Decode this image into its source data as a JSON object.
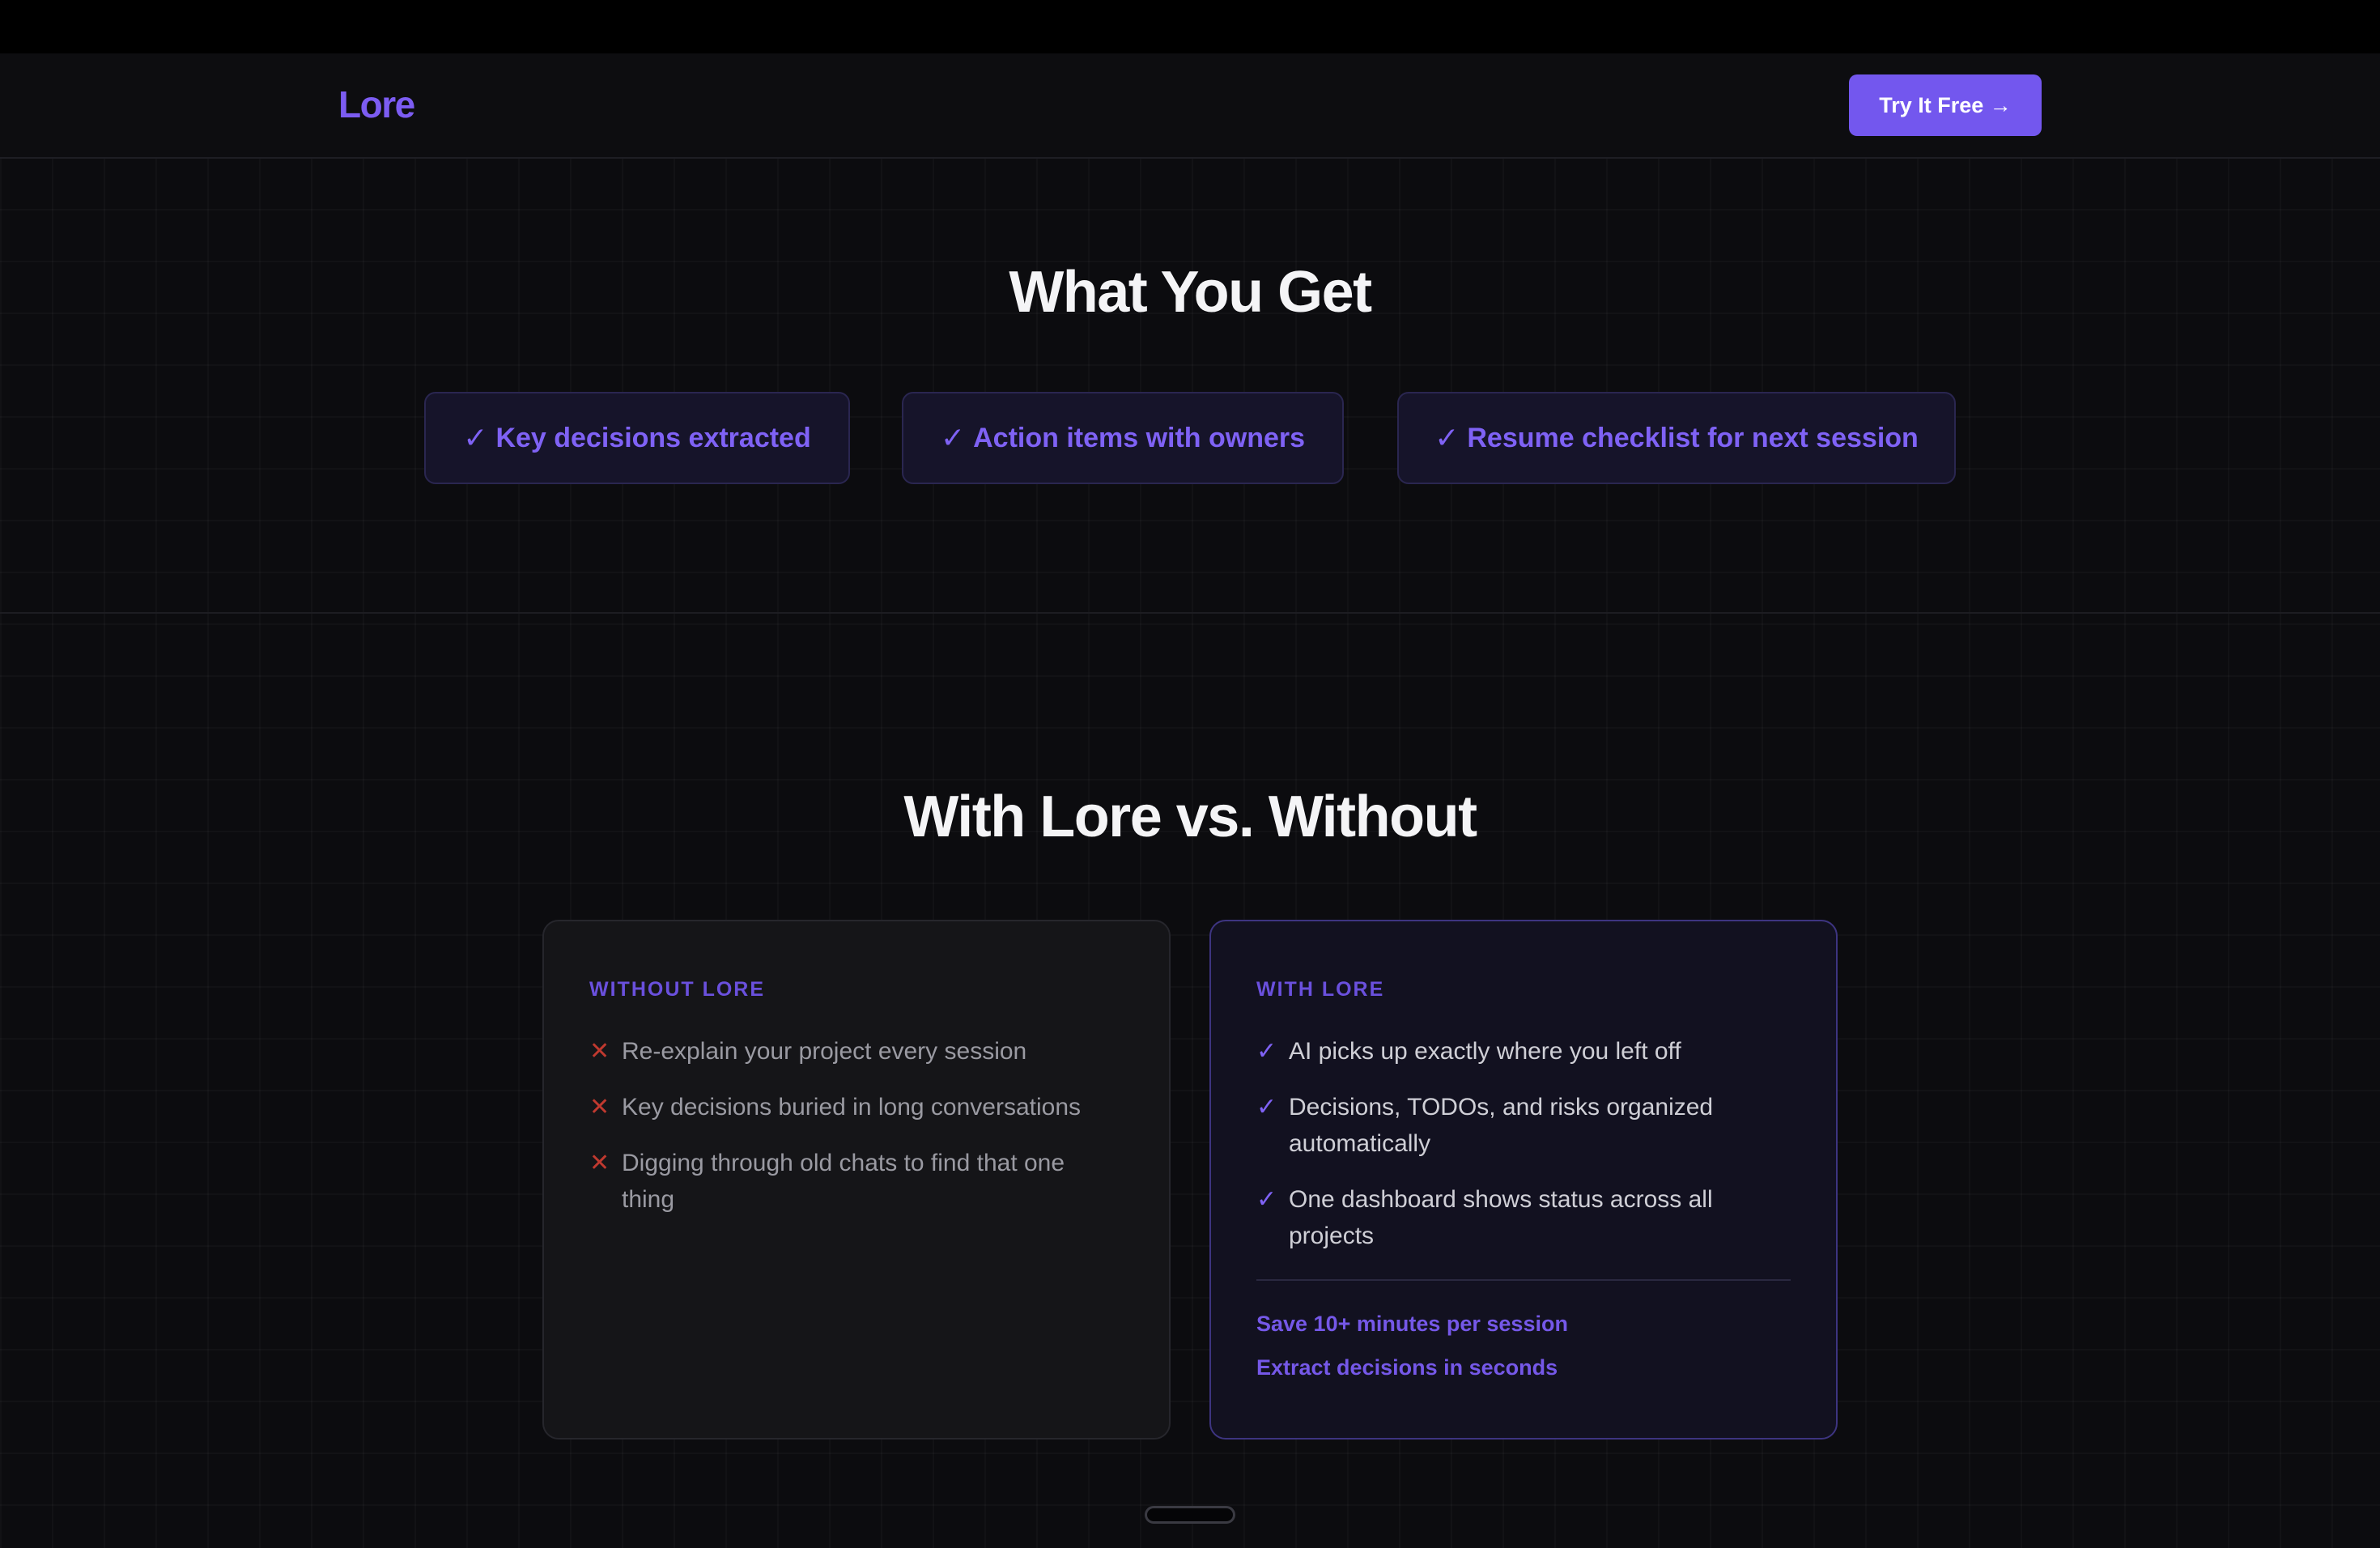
{
  "nav": {
    "logo": "Lore",
    "cta_label": "Try It Free →"
  },
  "what_you_get": {
    "title": "What You Get",
    "check_glyph": "✓",
    "items": [
      "Key decisions extracted",
      "Action items with owners",
      "Resume checklist for next session"
    ]
  },
  "comparison": {
    "title": "With Lore vs. Without",
    "without": {
      "heading": "WITHOUT LORE",
      "mark_glyph": "✕",
      "items": [
        "Re-explain your project every session",
        "Key decisions buried in long conversations",
        "Digging through old chats to find that one thing"
      ]
    },
    "with": {
      "heading": "WITH LORE",
      "mark_glyph": "✓",
      "items": [
        "AI picks up exactly where you left off",
        "Decisions, TODOs, and risks organized automatically",
        "One dashboard shows status across all projects"
      ],
      "stats": [
        "Save 10+ minutes per session",
        "Extract decisions in seconds"
      ]
    }
  },
  "colors": {
    "accent": "#7357ee",
    "background": "#0c0c0f",
    "negative": "#c0392f"
  }
}
